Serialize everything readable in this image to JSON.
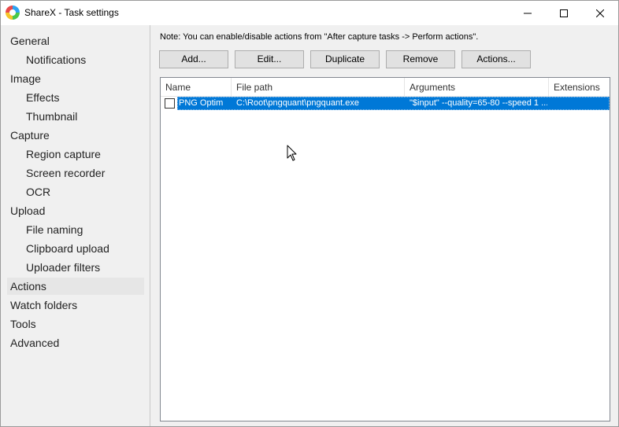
{
  "window": {
    "title": "ShareX - Task settings"
  },
  "sidebar": {
    "items": [
      {
        "label": "General"
      },
      {
        "label": "Notifications"
      },
      {
        "label": "Image"
      },
      {
        "label": "Effects"
      },
      {
        "label": "Thumbnail"
      },
      {
        "label": "Capture"
      },
      {
        "label": "Region capture"
      },
      {
        "label": "Screen recorder"
      },
      {
        "label": "OCR"
      },
      {
        "label": "Upload"
      },
      {
        "label": "File naming"
      },
      {
        "label": "Clipboard upload"
      },
      {
        "label": "Uploader filters"
      },
      {
        "label": "Actions"
      },
      {
        "label": "Watch folders"
      },
      {
        "label": "Tools"
      },
      {
        "label": "Advanced"
      }
    ],
    "selected": "Actions"
  },
  "actions_panel": {
    "note": "Note: You can enable/disable actions from \"After capture tasks -> Perform actions\".",
    "buttons": {
      "add": "Add...",
      "edit": "Edit...",
      "duplicate": "Duplicate",
      "remove": "Remove",
      "actions": "Actions..."
    },
    "columns": [
      "Name",
      "File path",
      "Arguments",
      "Extensions"
    ],
    "rows": [
      {
        "checked": false,
        "name": "PNG Optim",
        "file_path": "C:\\Root\\pngquant\\pngquant.exe",
        "arguments": "\"$input\" --quality=65-80 --speed 1 ...",
        "extensions": ""
      }
    ]
  },
  "colors": {
    "selection": "#0078d7",
    "sidebar_bg": "#f0f0f0"
  }
}
